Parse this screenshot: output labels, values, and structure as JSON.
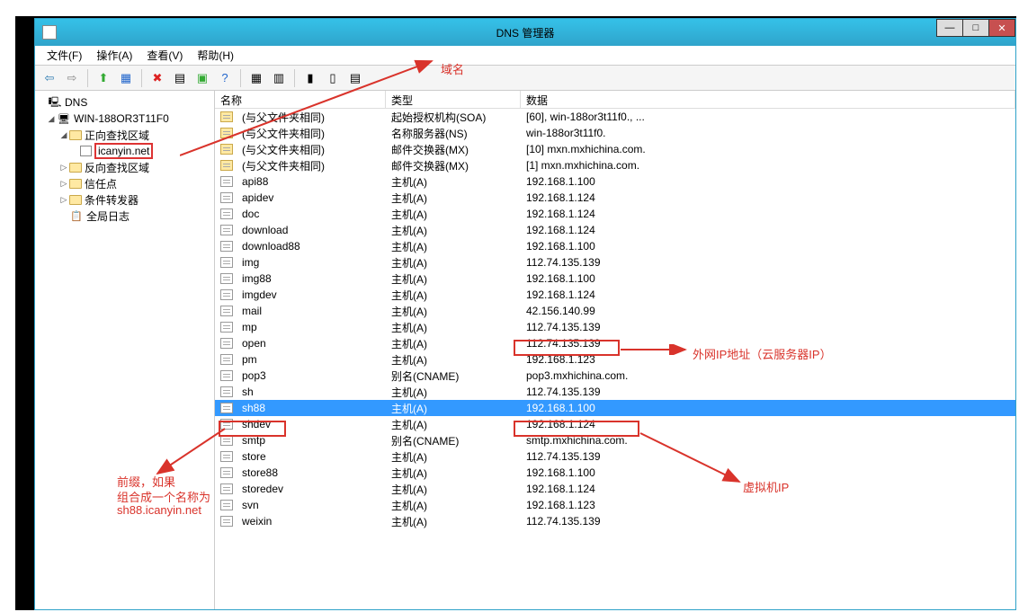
{
  "window": {
    "title": "DNS 管理器"
  },
  "menu": {
    "file": "文件(F)",
    "action": "操作(A)",
    "view": "查看(V)",
    "help": "帮助(H)"
  },
  "tree": {
    "root": "DNS",
    "server": "WIN-188OR3T11F0",
    "forward": "正向查找区域",
    "zone": "icanyin.net",
    "reverse": "反向查找区域",
    "trust": "信任点",
    "cond": "条件转发器",
    "log": "全局日志"
  },
  "columns": {
    "name": "名称",
    "type": "类型",
    "data": "数据"
  },
  "records": [
    {
      "name": "(与父文件夹相同)",
      "type": "起始授权机构(SOA)",
      "data": "[60], win-188or3t11f0., ...",
      "icon": "folder"
    },
    {
      "name": "(与父文件夹相同)",
      "type": "名称服务器(NS)",
      "data": "win-188or3t11f0.",
      "icon": "folder"
    },
    {
      "name": "(与父文件夹相同)",
      "type": "邮件交换器(MX)",
      "data": "[10]  mxn.mxhichina.com.",
      "icon": "folder"
    },
    {
      "name": "(与父文件夹相同)",
      "type": "邮件交换器(MX)",
      "data": "[1]  mxn.mxhichina.com.",
      "icon": "folder"
    },
    {
      "name": "api88",
      "type": "主机(A)",
      "data": "192.168.1.100",
      "icon": "rec"
    },
    {
      "name": "apidev",
      "type": "主机(A)",
      "data": "192.168.1.124",
      "icon": "rec"
    },
    {
      "name": "doc",
      "type": "主机(A)",
      "data": "192.168.1.124",
      "icon": "rec"
    },
    {
      "name": "download",
      "type": "主机(A)",
      "data": "192.168.1.124",
      "icon": "rec"
    },
    {
      "name": "download88",
      "type": "主机(A)",
      "data": "192.168.1.100",
      "icon": "rec"
    },
    {
      "name": "img",
      "type": "主机(A)",
      "data": "112.74.135.139",
      "icon": "rec"
    },
    {
      "name": "img88",
      "type": "主机(A)",
      "data": "192.168.1.100",
      "icon": "rec"
    },
    {
      "name": "imgdev",
      "type": "主机(A)",
      "data": "192.168.1.124",
      "icon": "rec"
    },
    {
      "name": "mail",
      "type": "主机(A)",
      "data": "42.156.140.99",
      "icon": "rec"
    },
    {
      "name": "mp",
      "type": "主机(A)",
      "data": "112.74.135.139",
      "icon": "rec"
    },
    {
      "name": "open",
      "type": "主机(A)",
      "data": "112.74.135.139",
      "icon": "rec"
    },
    {
      "name": "pm",
      "type": "主机(A)",
      "data": "192.168.1.123",
      "icon": "rec"
    },
    {
      "name": "pop3",
      "type": "别名(CNAME)",
      "data": "pop3.mxhichina.com.",
      "icon": "rec"
    },
    {
      "name": "sh",
      "type": "主机(A)",
      "data": "112.74.135.139",
      "icon": "rec"
    },
    {
      "name": "sh88",
      "type": "主机(A)",
      "data": "192.168.1.100",
      "icon": "rec",
      "selected": true
    },
    {
      "name": "shdev",
      "type": "主机(A)",
      "data": "192.168.1.124",
      "icon": "rec"
    },
    {
      "name": "smtp",
      "type": "别名(CNAME)",
      "data": "smtp.mxhichina.com.",
      "icon": "rec"
    },
    {
      "name": "store",
      "type": "主机(A)",
      "data": "112.74.135.139",
      "icon": "rec"
    },
    {
      "name": "store88",
      "type": "主机(A)",
      "data": "192.168.1.100",
      "icon": "rec"
    },
    {
      "name": "storedev",
      "type": "主机(A)",
      "data": "192.168.1.124",
      "icon": "rec"
    },
    {
      "name": "svn",
      "type": "主机(A)",
      "data": "192.168.1.123",
      "icon": "rec"
    },
    {
      "name": "weixin",
      "type": "主机(A)",
      "data": "112.74.135.139",
      "icon": "rec"
    }
  ],
  "annotations": {
    "domain": "域名",
    "wanip": "外网IP地址（云服务器IP）",
    "vmip": "虚拟机IP",
    "prefix1": "前缀，如果",
    "prefix2": "组合成一个名称为",
    "prefix3": "sh88.icanyin.net"
  }
}
